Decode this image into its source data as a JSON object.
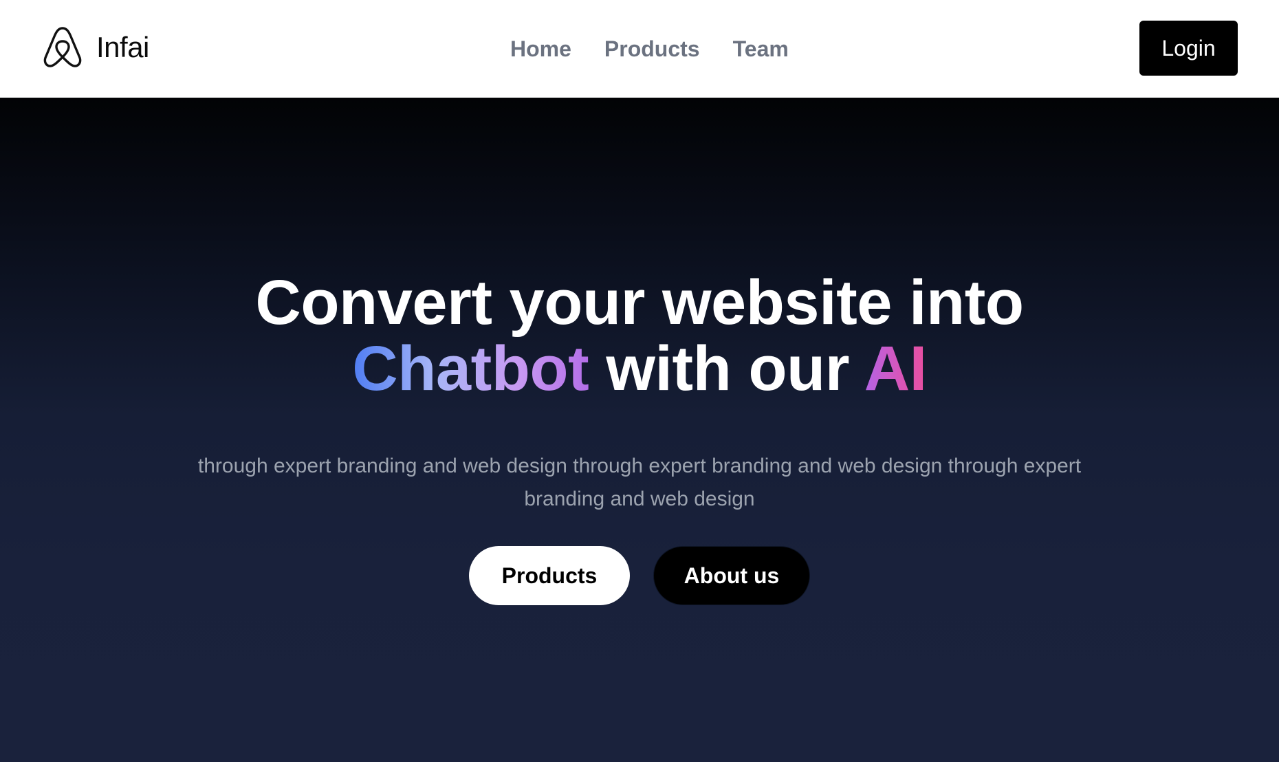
{
  "header": {
    "brand_name": "Infai",
    "nav": [
      "Home",
      "Products",
      "Team"
    ],
    "login_label": "Login"
  },
  "hero": {
    "headline_line1": "Convert your website into",
    "headline_word_chatbot": "Chatbot",
    "headline_middle": " with our ",
    "headline_word_ai": "AI",
    "subtext": "through expert branding and web design through expert branding and web design through expert branding and web design",
    "primary_cta": "Products",
    "secondary_cta": "About us"
  },
  "colors": {
    "hero_bg_top": "#020305",
    "hero_bg_bottom": "#1a223c",
    "chatbot_gradient_start": "#4f7df3",
    "chatbot_gradient_end": "#b46fe8",
    "ai_gradient_start": "#b464e6",
    "ai_gradient_end": "#e84f9f",
    "nav_text": "#6b7280",
    "subtext": "#9ca3af"
  },
  "icons": {
    "brand_logo": "airbnb-style-logo-icon"
  }
}
